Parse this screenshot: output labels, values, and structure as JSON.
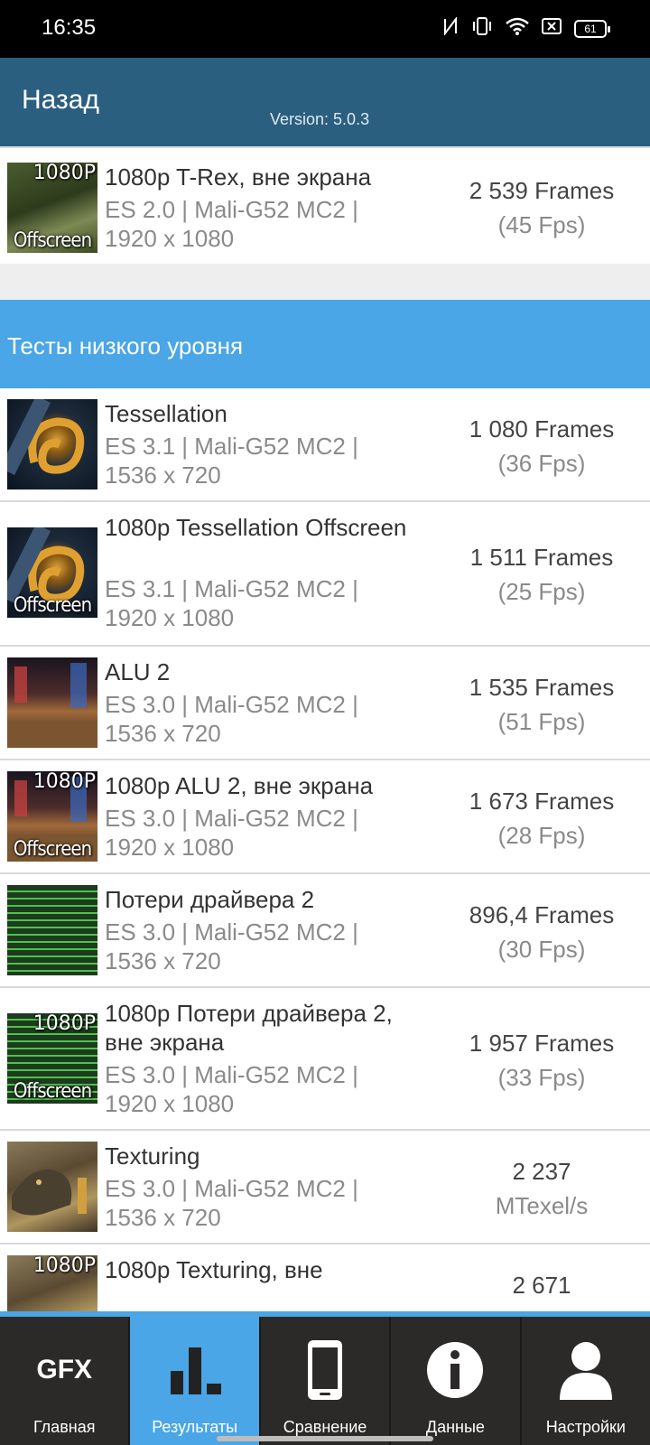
{
  "status": {
    "time": "16:35",
    "battery": "61"
  },
  "header": {
    "back_label": "Назад",
    "version": "Version: 5.0.3"
  },
  "section": {
    "low_level_title": "Тесты низкого уровня"
  },
  "tests": [
    {
      "title": "1080p T-Rex, вне экрана",
      "info": "ES 2.0 | Mali-G52 MC2 | 1920 x 1080",
      "result": "2 539 Frames",
      "sub": "(45 Fps)",
      "badge_top": "1080P",
      "badge_bottom": "Offscreen",
      "icon": "trex-thumbnail"
    },
    {
      "title": "Tessellation",
      "info": "ES 3.1 | Mali-G52 MC2 | 1536 x 720",
      "result": "1 080 Frames",
      "sub": "(36 Fps)",
      "badge_top": "",
      "badge_bottom": "",
      "icon": "tessellation-thumbnail"
    },
    {
      "title": "1080p Tessellation Offscreen",
      "info": "ES 3.1 | Mali-G52 MC2 | 1920 x 1080",
      "result": "1 511 Frames",
      "sub": "(25 Fps)",
      "badge_top": "",
      "badge_bottom": "Offscreen",
      "icon": "tessellation-thumbnail"
    },
    {
      "title": "ALU 2",
      "info": "ES 3.0 | Mali-G52 MC2 | 1536 x 720",
      "result": "1 535 Frames",
      "sub": "(51 Fps)",
      "badge_top": "",
      "badge_bottom": "",
      "icon": "alu-thumbnail"
    },
    {
      "title": "1080p ALU 2, вне экрана",
      "info": "ES 3.0 | Mali-G52 MC2 | 1920 x 1080",
      "result": "1 673 Frames",
      "sub": "(28 Fps)",
      "badge_top": "1080P",
      "badge_bottom": "Offscreen",
      "icon": "alu-thumbnail"
    },
    {
      "title": "Потери драйвера 2",
      "info": "ES 3.0 | Mali-G52 MC2 | 1536 x 720",
      "result": "896,4 Frames",
      "sub": "(30 Fps)",
      "badge_top": "",
      "badge_bottom": "",
      "icon": "driver-overhead-thumbnail"
    },
    {
      "title": "1080p Потери драйвера 2, вне экрана",
      "info": "ES 3.0 | Mali-G52 MC2 | 1920 x 1080",
      "result": "1 957 Frames",
      "sub": "(33 Fps)",
      "badge_top": "1080P",
      "badge_bottom": "Offscreen",
      "icon": "driver-overhead-thumbnail"
    },
    {
      "title": "Texturing",
      "info": "ES 3.0 | Mali-G52 MC2 | 1536 x 720",
      "result": "2 237",
      "sub": "MTexel/s",
      "badge_top": "",
      "badge_bottom": "",
      "icon": "texturing-thumbnail"
    },
    {
      "title": "1080p Texturing, вне",
      "info": "",
      "result": "2 671",
      "sub": "",
      "badge_top": "1080P",
      "badge_bottom": "",
      "icon": "texturing-thumbnail"
    }
  ],
  "nav": [
    {
      "label": "Главная",
      "icon": "gfx-logo-icon",
      "glyph": "GFX"
    },
    {
      "label": "Результаты",
      "icon": "bar-chart-icon",
      "active": true
    },
    {
      "label": "Сравнение",
      "icon": "phone-icon"
    },
    {
      "label": "Данные",
      "icon": "info-icon"
    },
    {
      "label": "Настройки",
      "icon": "user-icon"
    }
  ],
  "colors": {
    "header": "#2b5f7f",
    "accent": "#4aa6e6",
    "nav_bg": "#2b2a29"
  }
}
